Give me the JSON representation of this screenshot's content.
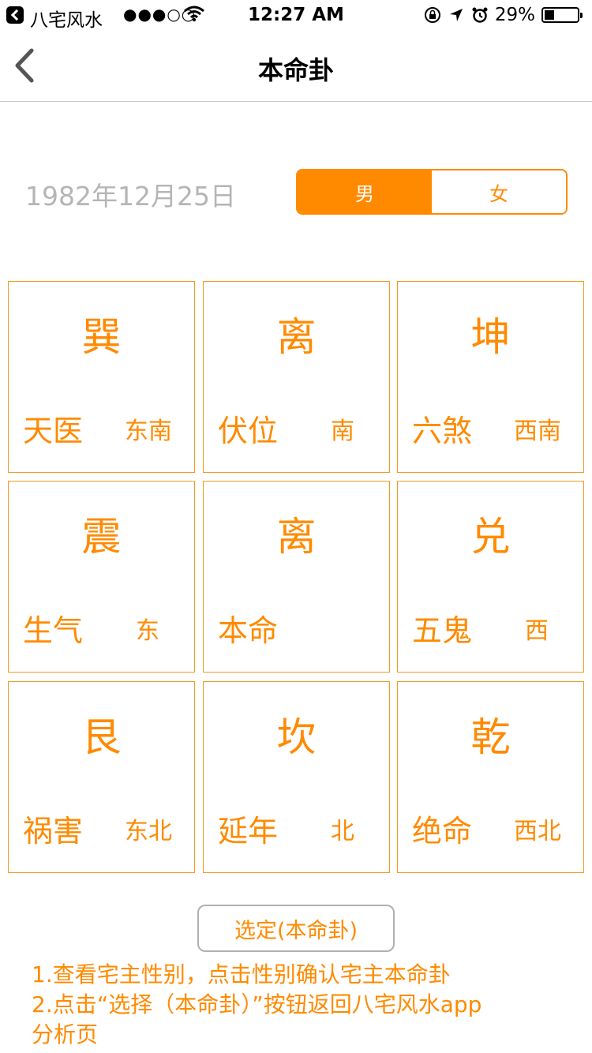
{
  "status_bar": {
    "app_name": "八宅风水",
    "signal": "●●●○○",
    "time": "12:27 AM",
    "battery": "29%"
  },
  "nav": {
    "title": "本命卦"
  },
  "birth_date": "1982年12月25日",
  "gender": {
    "male": "男",
    "female": "女",
    "selected": "male"
  },
  "grid": [
    {
      "gua": "巽",
      "star": "天医",
      "dir": "东南"
    },
    {
      "gua": "离",
      "star": "伏位",
      "dir": "南"
    },
    {
      "gua": "坤",
      "star": "六煞",
      "dir": "西南"
    },
    {
      "gua": "震",
      "star": "生气",
      "dir": "东"
    },
    {
      "gua": "离",
      "star": "本命",
      "dir": ""
    },
    {
      "gua": "兑",
      "star": "五鬼",
      "dir": "西"
    },
    {
      "gua": "艮",
      "star": "祸害",
      "dir": "东北"
    },
    {
      "gua": "坎",
      "star": "延年",
      "dir": "北"
    },
    {
      "gua": "乾",
      "star": "绝命",
      "dir": "西北"
    }
  ],
  "select_button": "选定(本命卦)",
  "notes": [
    "1.查看宅主性别，点击性别确认宅主本命卦",
    "2.点击“选择（本命卦）”按钮返回八宅风水app",
    "分析页"
  ],
  "colors": {
    "accent": "#ff8a00",
    "border": "#f59a23"
  }
}
